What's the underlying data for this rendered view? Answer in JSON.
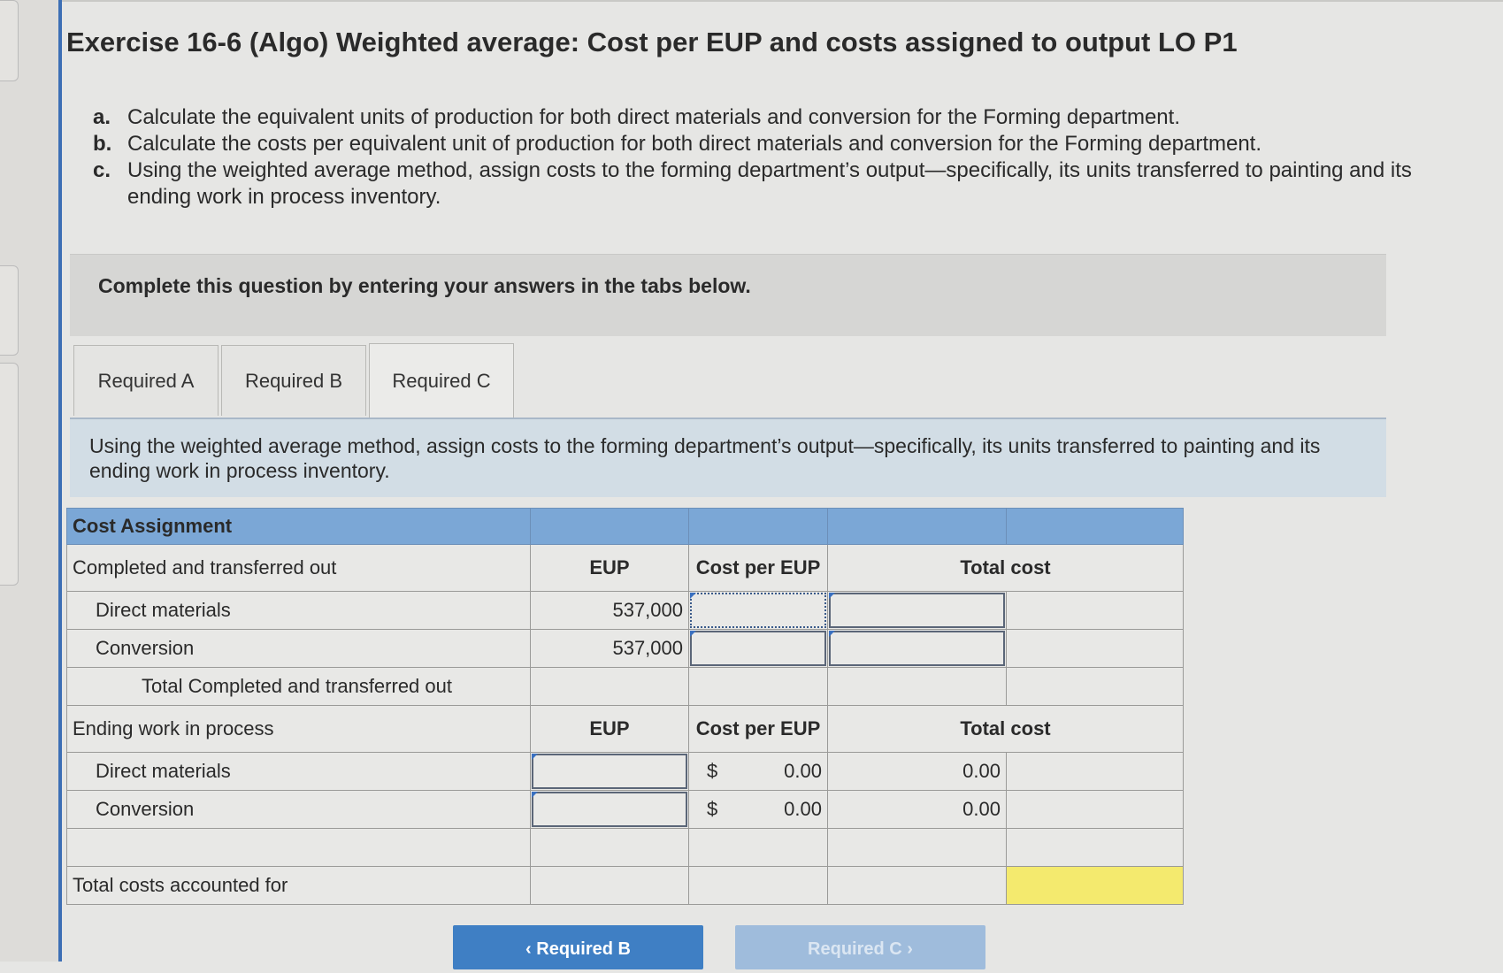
{
  "title": "Exercise 16-6 (Algo) Weighted average: Cost per EUP and costs assigned to output LO P1",
  "tasks": [
    {
      "mark": "a.",
      "text": "Calculate the equivalent units of production for both direct materials and conversion for the Forming department."
    },
    {
      "mark": "b.",
      "text": "Calculate the costs per equivalent unit of production for both direct materials and conversion for the Forming department."
    },
    {
      "mark": "c.",
      "text": "Using the weighted average method, assign costs to the forming department’s output—specifically, its units transferred to painting and its ending work in process inventory."
    }
  ],
  "banner": "Complete this question by entering your answers in the tabs below.",
  "tabs": [
    "Required A",
    "Required B",
    "Required C"
  ],
  "active_tab": "Required C",
  "instructions": "Using the weighted average method, assign costs to the forming department’s output—specifically, its units transferred to painting and its ending work in process inventory.",
  "table": {
    "header": "Cost Assignment",
    "completed": {
      "label": "Completed and transferred out",
      "col_eup": "EUP",
      "col_cost": "Cost per EUP",
      "col_total": "Total cost",
      "dm_label": "Direct materials",
      "dm_eup": "537,000",
      "conv_label": "Conversion",
      "conv_eup": "537,000",
      "total_label": "Total Completed and transferred out"
    },
    "ending": {
      "label": "Ending work in process",
      "col_eup": "EUP",
      "col_cost": "Cost per EUP",
      "col_total": "Total cost",
      "dm_label": "Direct materials",
      "dm_currency": "$",
      "dm_cost": "0.00",
      "dm_total": "0.00",
      "conv_label": "Conversion",
      "conv_currency": "$",
      "conv_cost": "0.00",
      "conv_total": "0.00"
    },
    "total_accounted_label": "Total costs accounted for"
  },
  "nav": {
    "prev_label": "Required B",
    "next_label": "Required C",
    "prev_arrow": "‹",
    "next_arrow": "›"
  },
  "colors": {
    "header_blue": "#7ba7d6",
    "instruction_bg": "#d2dde5",
    "highlight_yellow": "#f4ea6e",
    "button_blue": "#3f7fc4"
  }
}
